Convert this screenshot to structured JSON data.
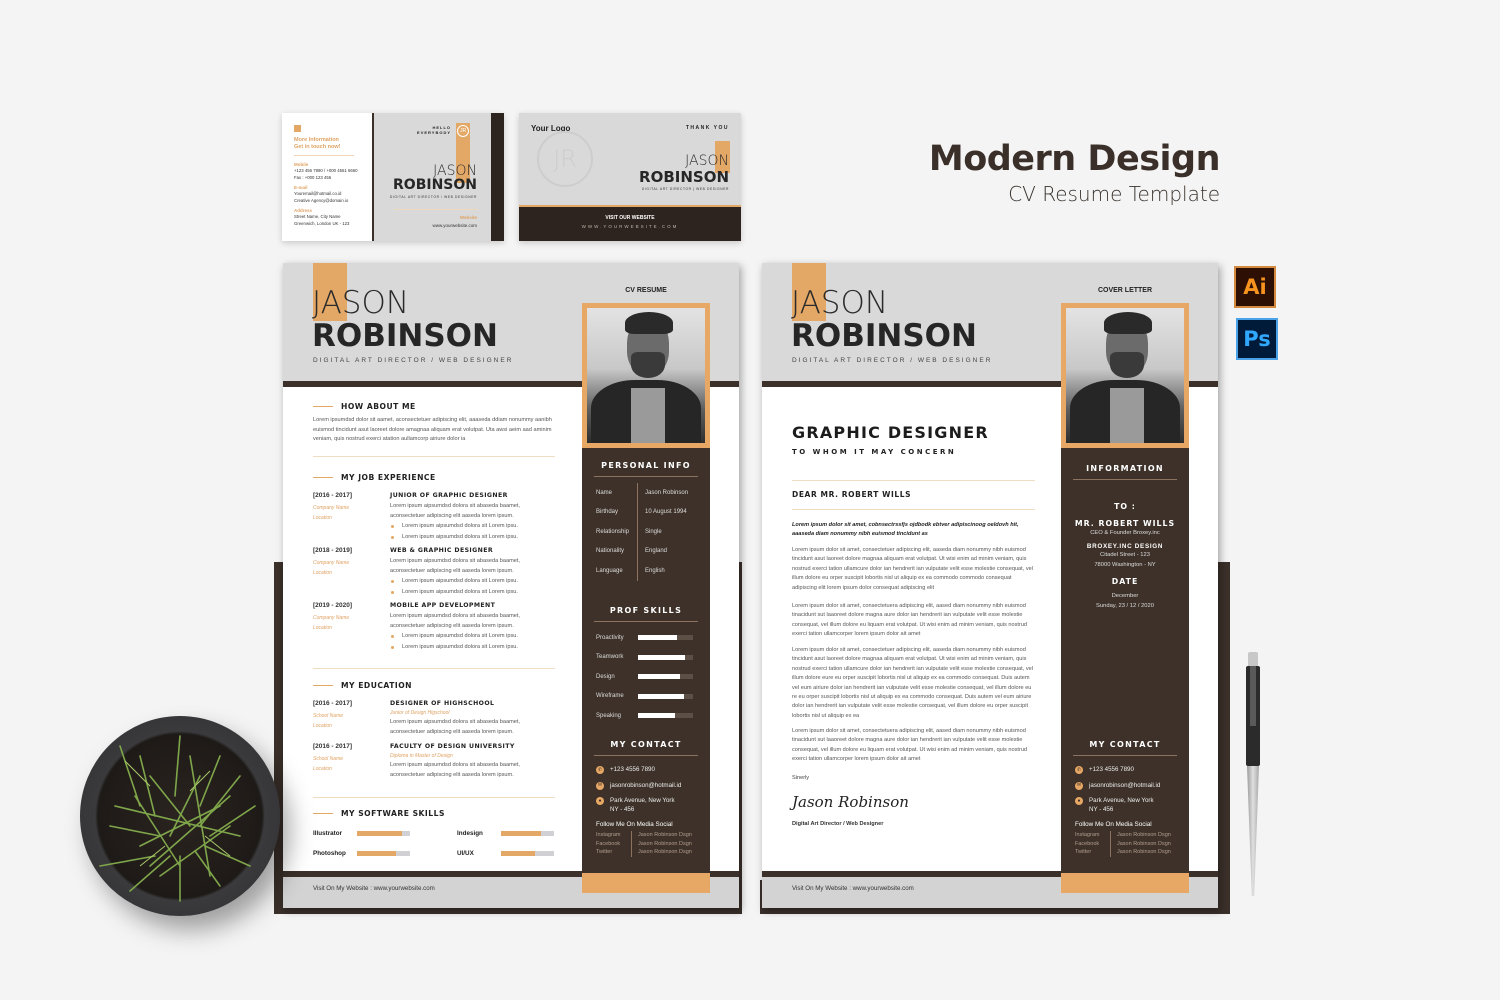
{
  "headline": {
    "title": "Modern Design",
    "subtitle": "CV Resume Template"
  },
  "software_icons": [
    {
      "name": "illustrator-icon",
      "label": "Ai"
    },
    {
      "name": "photoshop-icon",
      "label": "Ps"
    }
  ],
  "business_card_front": {
    "more_info": "More Information",
    "get_in_touch": "Get in touch now!",
    "mobile_label": "Mobile",
    "mobile_value": "+123 456 7890 / +000 4561 6660",
    "fax_value": "Fax : +000 123 456",
    "email_label": "E-mail",
    "email_value1": "Youremail@hotmail.co.id",
    "email_value2": "Creative Agency@domain.io",
    "address_label": "Address",
    "address_value1": "Street Name, City Name",
    "address_value2": "Greenwich, London UK - 123",
    "hello": "HELLO",
    "everybody": "EVERYBODY",
    "first_name": "JASON",
    "last_name": "ROBINSON",
    "role": "DIGITAL ART DIRECTOR / WEB DESIGNER",
    "website_label": "Website",
    "website_value": "www.yourwebsite.com"
  },
  "business_card_back": {
    "logo": "Your Logo",
    "monogram": "JR",
    "thank_you": "THANK YOU",
    "first_name": "JASON",
    "last_name": "ROBINSON",
    "role": "DIGITAL ART DIRECTOR | WEB DESIGNER",
    "visit": "VISIT OUR WEBSITE",
    "website": "WWW.YOURWEBSITE.COM"
  },
  "resume": {
    "first_name": "JASON",
    "last_name": "ROBINSON",
    "role": "DIGITAL ART DIRECTOR / WEB DESIGNER",
    "doc_label": "CV RESUME",
    "about": {
      "heading": "HOW ABOUT ME",
      "text": "Lorem ipsumdsd dolor sit aamet, aconsectetuer adipiscing elit, aaaseda ddiam nonummy aanibh euismod tincidunt asut laoreet dolore amagnaa aliquam erat volutpat. Uta awsi aeim aad aminim veniam, quis nostrud exerci atation aullamcorp airiure dolor ia"
    },
    "experience": {
      "heading": "MY JOB EXPERIENCE",
      "items": [
        {
          "years": "[2016 - 2017]",
          "company": "Company Name",
          "location": "Location",
          "title": "JUNIOR OF GRAPHIC DESIGNER",
          "desc": "Lorem ipsum aipsumdsd dolora sit abaseda baamet, aconsectetuer adipiscing elit aaseda lorem ipsum.",
          "bullets": [
            "Lorem ipsum aipsumdsd dolora sit Lorem ipsu.",
            "Lorem ipsum aipsumdsd dolora sit Lorem ipsu."
          ]
        },
        {
          "years": "[2018 - 2019]",
          "company": "Company Name",
          "location": "Location",
          "title": "WEB & GRAPHIC DESIGNER",
          "desc": "Lorem ipsum aipsumdsd dolora sit abaseda baamet, aconsectetuer adipiscing elit aaseda lorem ipsum.",
          "bullets": [
            "Lorem ipsum aipsumdsd dolora sit Lorem ipsu.",
            "Lorem ipsum aipsumdsd dolora sit Lorem ipsu."
          ]
        },
        {
          "years": "[2019 - 2020]",
          "company": "Company Name",
          "location": "Location",
          "title": "MOBILE APP DEVELOPMENT",
          "desc": "Lorem ipsum aipsumdsd dolora sit abaseda baamet, aconsectetuer adipiscing elit aaseda lorem ipsum.",
          "bullets": [
            "Lorem ipsum aipsumdsd dolora sit Lorem ipsu.",
            "Lorem ipsum aipsumdsd dolora sit Lorem ipsu."
          ]
        }
      ]
    },
    "education": {
      "heading": "MY EDUCATION",
      "items": [
        {
          "years": "[2016 - 2017]",
          "school": "School Name",
          "location": "Location",
          "title": "DESIGNER OF HIGHSCHOOL",
          "subtitle": "Junior of Design Higschool",
          "desc": "Lorem ipsum aipsumdsd dolora sit abaseda baamet, aconsectetuer adipiscing elit aaseda lorem ipsum."
        },
        {
          "years": "[2016 - 2017]",
          "school": "School Name",
          "location": "Location",
          "title": "FACULTY OF DESIGN UNIVERSITY",
          "subtitle": "Diploma in Master of Design",
          "desc": "Lorem ipsum aipsumdsd dolora sit abaseda baamet, aconsectetuer adipiscing elit aaseda lorem ipsum."
        }
      ]
    },
    "software": {
      "heading": "MY SOFTWARE SKILLS",
      "items": [
        {
          "name": "Illustrator",
          "level": 0.84
        },
        {
          "name": "Indesign",
          "level": 0.75
        },
        {
          "name": "Photoshop",
          "level": 0.74
        },
        {
          "name": "UI/UX",
          "level": 0.65
        }
      ]
    },
    "personal": {
      "heading": "PERSONAL INFO",
      "rows": [
        {
          "key": "Name",
          "value": "Jason Robinson"
        },
        {
          "key": "Birthday",
          "value": "10 August 1994"
        },
        {
          "key": "Relationship",
          "value": "Single"
        },
        {
          "key": "Nationality",
          "value": "England"
        },
        {
          "key": "Language",
          "value": "English"
        }
      ]
    },
    "skills": {
      "heading": "PROF SKILLS",
      "items": [
        {
          "name": "Proactivity",
          "level": 0.7
        },
        {
          "name": "Teamwork",
          "level": 0.85
        },
        {
          "name": "Design",
          "level": 0.77
        },
        {
          "name": "Wireframe",
          "level": 0.83
        },
        {
          "name": "Speaking",
          "level": 0.68
        }
      ]
    },
    "contact": {
      "heading": "MY CONTACT",
      "phone": "+123 4556 7890",
      "email": "jasonrobinson@hotmail.id",
      "address1": "Park Avenue, New York",
      "address2": "NY - 456",
      "social_heading": "Follow Me On Media Social",
      "social": [
        {
          "network": "Instagram",
          "handle": "Jason Robinson Dsgn"
        },
        {
          "network": "Facebook",
          "handle": "Jason Robinson Dsgn"
        },
        {
          "network": "Twitter",
          "handle": "Jason Robinson Dsgn"
        }
      ]
    },
    "footer": "Visit On My Website : www.yourwebsite.com"
  },
  "cover_letter": {
    "first_name": "JASON",
    "last_name": "ROBINSON",
    "role": "DIGITAL ART DIRECTOR / WEB DESIGNER",
    "doc_label": "COVER LETTER",
    "position": "GRAPHIC DESIGNER",
    "salutation_top": "TO WHOM IT MAY CONCERN",
    "dear": "DEAR MR. ROBERT WILLS",
    "intro": "Lorem ipsum dolor sit amet, cobnsectrssfjs ojdbodk ebtver adipiscinoog oeldovh hit, aaaseda diam nonummy nibh euismod tincidunt as",
    "paragraphs": [
      "Lorem ipsum dolor sit amet, consectetuer adipiscing elit, aaseda diam nonummy nibh euismod tincidunt asut laoreet dolore magnaa aliquam erat volutpat. Ut wisi enim ad minim veniam, quis nostrud exerci tation ullamcure dolor ian hendrerit ian vulputate velit esse molestie consequat, vel illum dolore eu orper suscipit lobortis nisl ut aliquip ex ea commodo commodo consequat adipiscing elit lorem ipsum dolor consequat adipiscing elit",
      "Lorem ipsum dolor sit amet, consectetuera adipiscing elit, aased diam nonummy nibh euismod tinacidunt sut laaoreet dolore magna aure dolor ian hendrerit ian vulputate velit esse molestie consequat, vel illum dolore eu liquam erat volutpat. Ut wisi enim ad minim veniam, quis nostrud exerci tation ullamcorper lorem ipsum dolor ait amet",
      "Lorem ipsum dolor sit amet, consectetuer adipiscing elit, aaseda diam nonummy nibh euismod tincidunt asut laoreet dolore magnaa aliquam erat volutpat. Ut wisi enim ad minim veniam, quis nostrud exerci tation ullamcure dolor ian hendrerit ian vulputate velit esse molestie consequat, vel illum dolore eure eu orper suscipit lobortis nisl ut aliquip ex ea commodo consequat. Duis autem vel eum airiure dolor ian hendrerit ian vulputate velit esse molestie consequat, vel illum dolore eu re eu orper suscipit lobortis nisl ut aliquip ex ea commodo consequat. Duis autem vel eum airiure dolor ian hendrerit ian vulputate velit esse molestie consequat, vel illum dolore eu orper suscipit lobortis nisl ut aliquip ex ea",
      "Lorem ipsum dolor sit amet, consectetuera adipiscing elit, aased diam nonummy nibh euismod tinacidunt sut laaoreet dolore magna aure dolor ian hendrerit ian vulputate velit esse molestie consequat, vel illum dolore eu liquam erat volutpat. Ut wisi enim ad minim veniam, quis nostrud exerci tation ullamcorper lorem ipsum dolor ait amet"
    ],
    "closing": "Sinerly",
    "signature": "Jason Robinson",
    "sign_role": "Digital Art Director  / Web Designer",
    "info": {
      "heading": "INFORMATION",
      "to_label": "TO :",
      "recipient": "MR. ROBERT WILLS",
      "recipient_role": "CEO & Founder Broxey.inc",
      "company": "BROXEY.INC DESIGN",
      "street": "Citadel Street - 123",
      "city": "78000 Washington - NY",
      "date_label": "DATE",
      "month": "December",
      "date": "Sunday, 23 / 12 / 2020"
    },
    "contact": {
      "heading": "MY CONTACT",
      "phone": "+123 4556 7890",
      "email": "jasonrobinson@hotmail.id",
      "address1": "Park Avenue, New York",
      "address2": "NY - 456",
      "social_heading": "Follow Me On Media Social",
      "social": [
        {
          "network": "Instagram",
          "handle": "Jason Robinson Dsgn"
        },
        {
          "network": "Facebook",
          "handle": "Jason Robinson Dsgn"
        },
        {
          "network": "Twitter",
          "handle": "Jason Robinson Dsgn"
        }
      ]
    },
    "footer": "Visit On My Website : www.yourwebsite.com"
  },
  "colors": {
    "accent": "#e4a866",
    "dark": "#3b302a",
    "header_gray": "#d9d9d9"
  }
}
